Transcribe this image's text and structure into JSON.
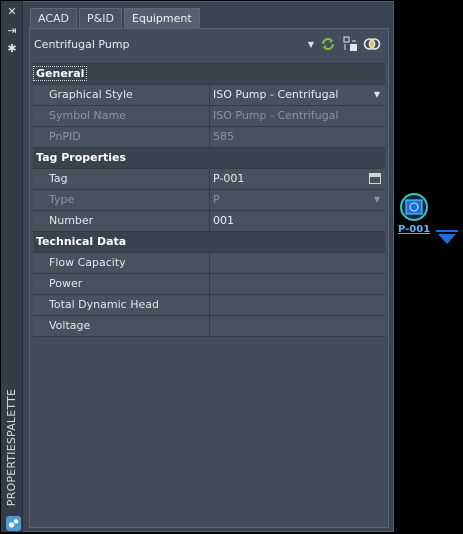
{
  "palette": {
    "title": "PROPERTIESPALETTE",
    "tabs": [
      {
        "label": "ACAD",
        "active": false
      },
      {
        "label": "P&ID",
        "active": false
      },
      {
        "label": "Equipment",
        "active": true
      }
    ],
    "selector": {
      "value": "Centrifugal Pump"
    },
    "icons": [
      "refresh-icon",
      "select-objects-icon",
      "quick-select-icon"
    ]
  },
  "categories": {
    "general": {
      "label": "General",
      "rows": [
        {
          "name": "Graphical Style",
          "value": "ISO Pump - Centrifugal"
        },
        {
          "name": "Symbol Name",
          "value": "ISO Pump - Centrifugal"
        },
        {
          "name": "PnPID",
          "value": "585"
        }
      ]
    },
    "tag": {
      "label": "Tag Properties",
      "rows": [
        {
          "name": "Tag",
          "value": "P-001"
        },
        {
          "name": "Type",
          "value": "P"
        },
        {
          "name": "Number",
          "value": "001"
        }
      ]
    },
    "technical": {
      "label": "Technical Data",
      "rows": [
        {
          "name": "Flow Capacity",
          "value": ""
        },
        {
          "name": "Power",
          "value": ""
        },
        {
          "name": "Total Dynamic Head",
          "value": ""
        },
        {
          "name": "Voltage",
          "value": ""
        }
      ]
    }
  },
  "drawing": {
    "pump_tag": "P-001"
  },
  "colors": {
    "accent_green": "#7ec23a",
    "tag_blue": "#5bb4ff",
    "pump_cyan": "#36c6c2",
    "marker_blue": "#1a6fe0"
  }
}
